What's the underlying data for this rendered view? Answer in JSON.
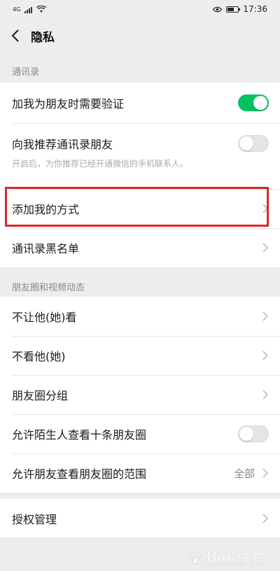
{
  "status_bar": {
    "network": "4G",
    "time": "17:36"
  },
  "header": {
    "title": "隐私"
  },
  "sections": {
    "contacts": {
      "title": "通讯录",
      "items": [
        {
          "label": "加我为朋友时需要验证",
          "toggle": "on"
        },
        {
          "label": "向我推荐通讯录朋友",
          "toggle": "off",
          "description": "开启后，为你推荐已经开通微信的手机联系人。"
        },
        {
          "label": "添加我的方式"
        },
        {
          "label": "通讯录黑名单"
        }
      ]
    },
    "moments": {
      "title": "朋友圈和视频动态",
      "items": [
        {
          "label": "不让他(她)看"
        },
        {
          "label": "不看他(她)"
        },
        {
          "label": "朋友圈分组"
        },
        {
          "label": "允许陌生人查看十条朋友圈",
          "toggle": "off"
        },
        {
          "label": "允许朋友查看朋友圈的范围",
          "value": "全部"
        }
      ]
    },
    "auth": {
      "items": [
        {
          "label": "授权管理"
        }
      ]
    }
  },
  "watermark": {
    "text": "Bai 经验",
    "sub": "jingyan.baidu.com"
  },
  "colors": {
    "toggle_on": "#07c160",
    "highlight": "#d8282b",
    "background": "#ededed"
  }
}
